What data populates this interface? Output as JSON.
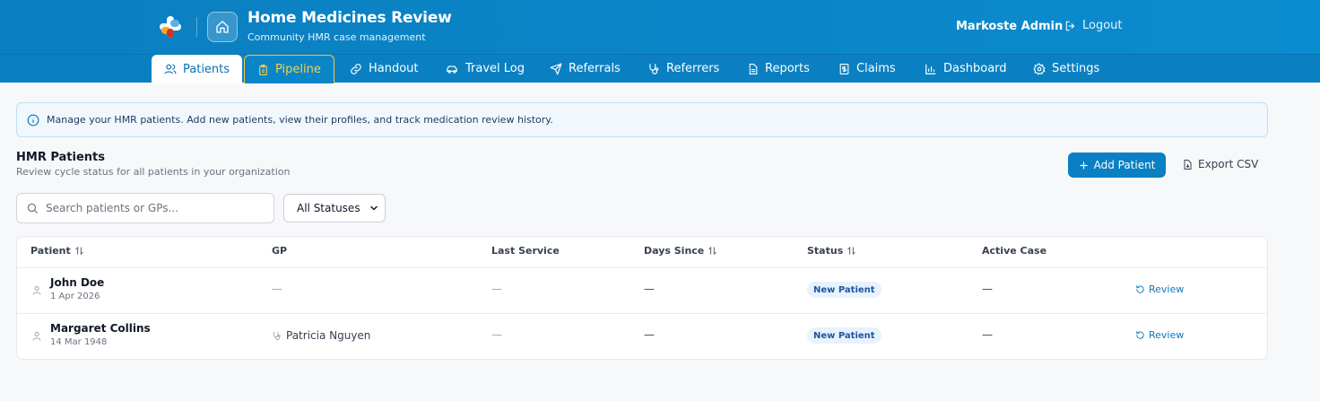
{
  "header": {
    "app_title": "Home Medicines Review",
    "app_subtitle": "Community HMR case management",
    "user_name": "Markoste Admin",
    "logout_label": "Logout"
  },
  "nav": {
    "tabs": [
      {
        "label": "Patients",
        "icon": "users-icon",
        "active": true
      },
      {
        "label": "Pipeline",
        "icon": "clipboard-icon",
        "highlight": true
      },
      {
        "label": "Handout",
        "icon": "link-icon"
      },
      {
        "label": "Travel Log",
        "icon": "car-icon"
      },
      {
        "label": "Referrals",
        "icon": "send-icon"
      },
      {
        "label": "Referrers",
        "icon": "stethoscope-icon"
      },
      {
        "label": "Reports",
        "icon": "document-icon"
      },
      {
        "label": "Claims",
        "icon": "dollar-icon"
      },
      {
        "label": "Dashboard",
        "icon": "bar-chart-icon"
      },
      {
        "label": "Settings",
        "icon": "gear-icon"
      }
    ]
  },
  "info_banner": "Manage your HMR patients. Add new patients, view their profiles, and track medication review history.",
  "section": {
    "title": "HMR Patients",
    "subtitle": "Review cycle status for all patients in your organization",
    "add_label": "Add Patient",
    "export_label": "Export CSV"
  },
  "filters": {
    "search_placeholder": "Search patients or GPs...",
    "status_selected": "All Statuses"
  },
  "table": {
    "columns": [
      "Patient",
      "GP",
      "Last Service",
      "Days Since",
      "Status",
      "Active Case"
    ],
    "rows": [
      {
        "name": "John Doe",
        "dob": "1 Apr 2026",
        "gp": "—",
        "last_service": "—",
        "days_since": "—",
        "status": "New Patient",
        "active_case": "—",
        "action": "Review"
      },
      {
        "name": "Margaret Collins",
        "dob": "14 Mar 1948",
        "gp": "Patricia Nguyen",
        "last_service": "—",
        "days_since": "—",
        "status": "New Patient",
        "active_case": "—",
        "action": "Review"
      }
    ]
  },
  "colors": {
    "header_blue": "#0a80c2",
    "accent": "#0a7fc3",
    "pipeline_gold": "#f6cf4d"
  }
}
